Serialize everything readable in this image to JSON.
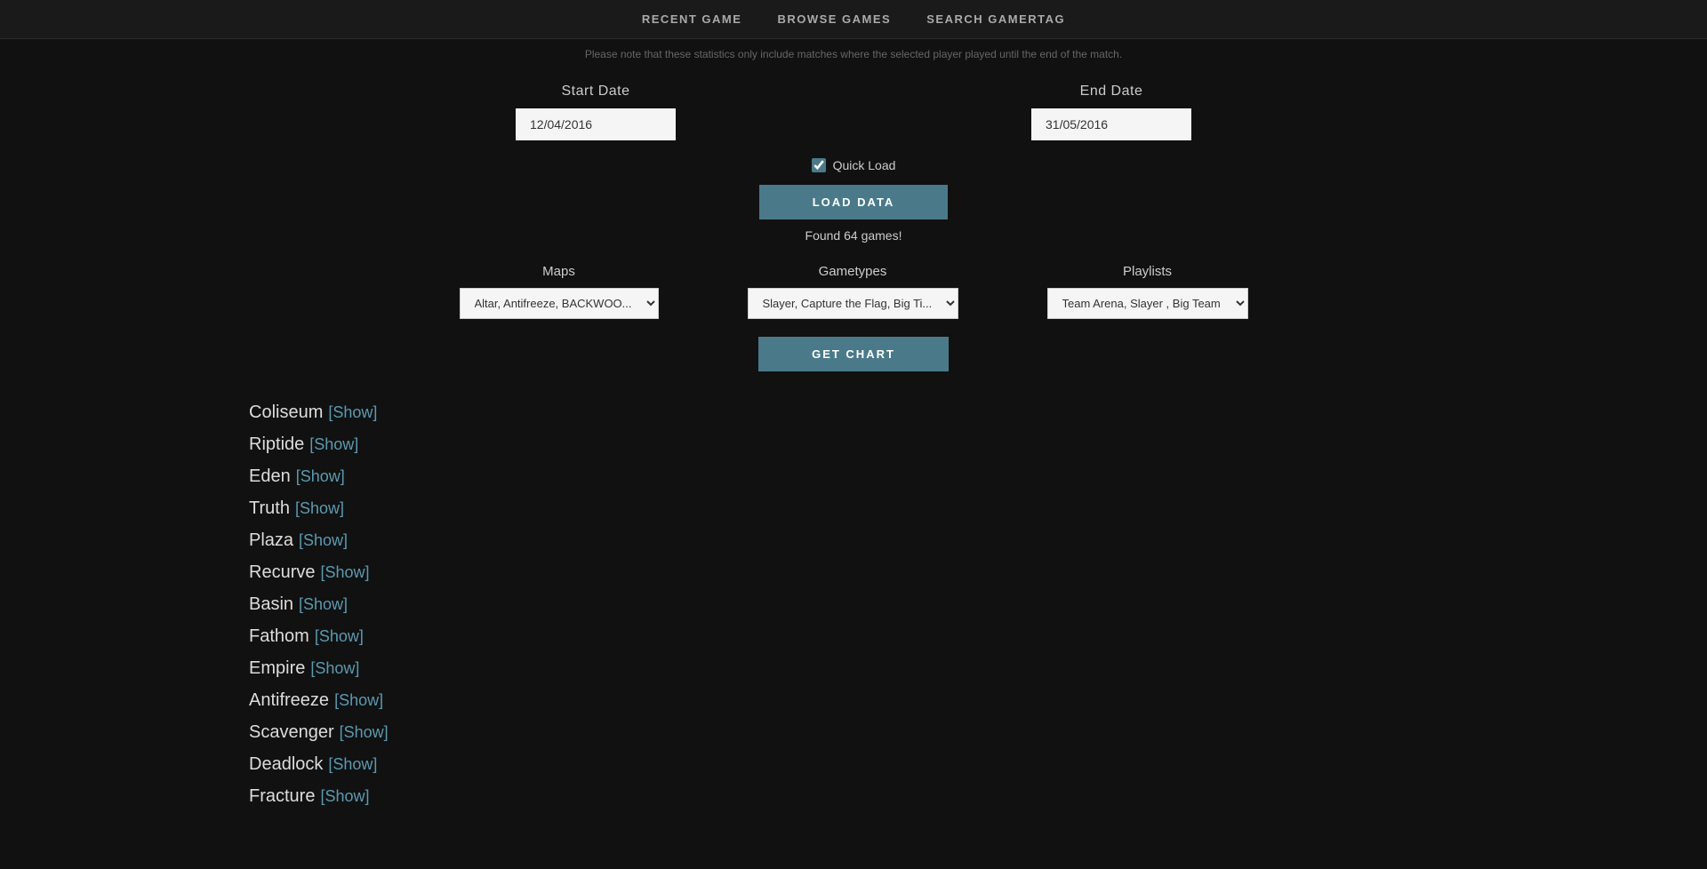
{
  "nav": {
    "items": [
      {
        "label": "RECENT GAME",
        "id": "recent-game"
      },
      {
        "label": "BROWSE GAMES",
        "id": "browse-games"
      },
      {
        "label": "SEARCH GAMERTAG",
        "id": "search-gamertag"
      }
    ]
  },
  "notice": {
    "text": "Please note that these statistics only include matches where the selected player played until the end of the match."
  },
  "dates": {
    "start_label": "Start Date",
    "start_value": "12/04/2016",
    "end_label": "End Date",
    "end_value": "31/05/2016"
  },
  "quick_load": {
    "label": "Quick Load",
    "checked": true
  },
  "load_data": {
    "label": "LOAD DATA",
    "found_text": "Found 64 games!"
  },
  "filters": {
    "maps_label": "Maps",
    "maps_value": "Altar, Antifreeze, BACKWOO...",
    "gametypes_label": "Gametypes",
    "gametypes_value": "Slayer, Capture the Flag, Big Ti...",
    "playlists_label": "Playlists",
    "playlists_value": "Team Arena, Slayer , Big Team"
  },
  "get_chart": {
    "label": "GET CHART"
  },
  "maps": [
    {
      "name": "Coliseum",
      "show": "[Show]"
    },
    {
      "name": "Riptide",
      "show": "[Show]"
    },
    {
      "name": "Eden",
      "show": "[Show]"
    },
    {
      "name": "Truth",
      "show": "[Show]"
    },
    {
      "name": "Plaza",
      "show": "[Show]"
    },
    {
      "name": "Recurve",
      "show": "[Show]"
    },
    {
      "name": "Basin",
      "show": "[Show]"
    },
    {
      "name": "Fathom",
      "show": "[Show]"
    },
    {
      "name": "Empire",
      "show": "[Show]"
    },
    {
      "name": "Antifreeze",
      "show": "[Show]"
    },
    {
      "name": "Scavenger",
      "show": "[Show]"
    },
    {
      "name": "Deadlock",
      "show": "[Show]"
    },
    {
      "name": "Fracture",
      "show": "[Show]"
    }
  ],
  "colors": {
    "accent": "#4a7a8a",
    "show_link": "#5a9ab0",
    "background": "#111111",
    "text_primary": "#cccccc"
  }
}
